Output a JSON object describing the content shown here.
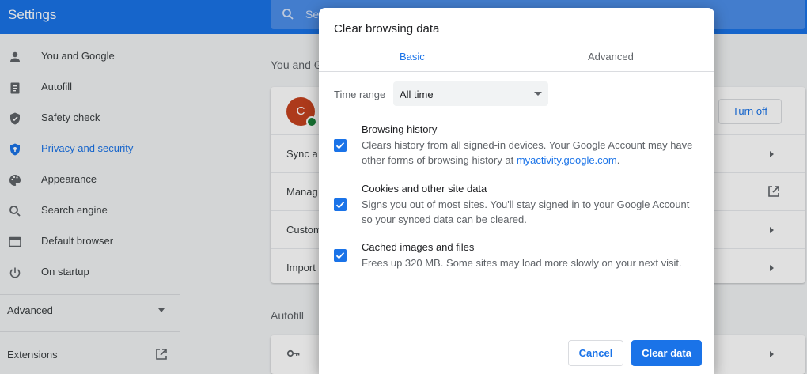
{
  "app": {
    "title": "Settings",
    "search_placeholder": "Se"
  },
  "sidebar": {
    "items": [
      {
        "label": "You and Google",
        "icon": "person-icon"
      },
      {
        "label": "Autofill",
        "icon": "clipboard-icon"
      },
      {
        "label": "Safety check",
        "icon": "shield-icon"
      },
      {
        "label": "Privacy and security",
        "icon": "shield-lock-icon",
        "active": true
      },
      {
        "label": "Appearance",
        "icon": "palette-icon"
      },
      {
        "label": "Search engine",
        "icon": "search-icon"
      },
      {
        "label": "Default browser",
        "icon": "browser-icon"
      },
      {
        "label": "On startup",
        "icon": "power-icon"
      }
    ],
    "advanced_label": "Advanced",
    "extensions_label": "Extensions"
  },
  "main": {
    "section_you": "You and G",
    "avatar_letter": "C",
    "turn_off_label": "Turn off",
    "rows": [
      "Sync a",
      "Manag",
      "Custom",
      "Import"
    ],
    "section_autofill": "Autofill"
  },
  "dialog": {
    "title": "Clear browsing data",
    "tabs": {
      "basic": "Basic",
      "advanced": "Advanced"
    },
    "time_range_label": "Time range",
    "time_range_value": "All time",
    "options": [
      {
        "title": "Browsing history",
        "desc_pre": "Clears history from all signed-in devices. Your Google Account may have other forms of browsing history at ",
        "link": "myactivity.google.com",
        "desc_post": ".",
        "checked": true
      },
      {
        "title": "Cookies and other site data",
        "desc": "Signs you out of most sites. You'll stay signed in to your Google Account so your synced data can be cleared.",
        "checked": true
      },
      {
        "title": "Cached images and files",
        "desc": "Frees up 320 MB. Some sites may load more slowly on your next visit.",
        "checked": true
      }
    ],
    "cancel_label": "Cancel",
    "clear_label": "Clear data"
  },
  "colors": {
    "accent": "#1a73e8",
    "avatar": "#c5431f"
  }
}
